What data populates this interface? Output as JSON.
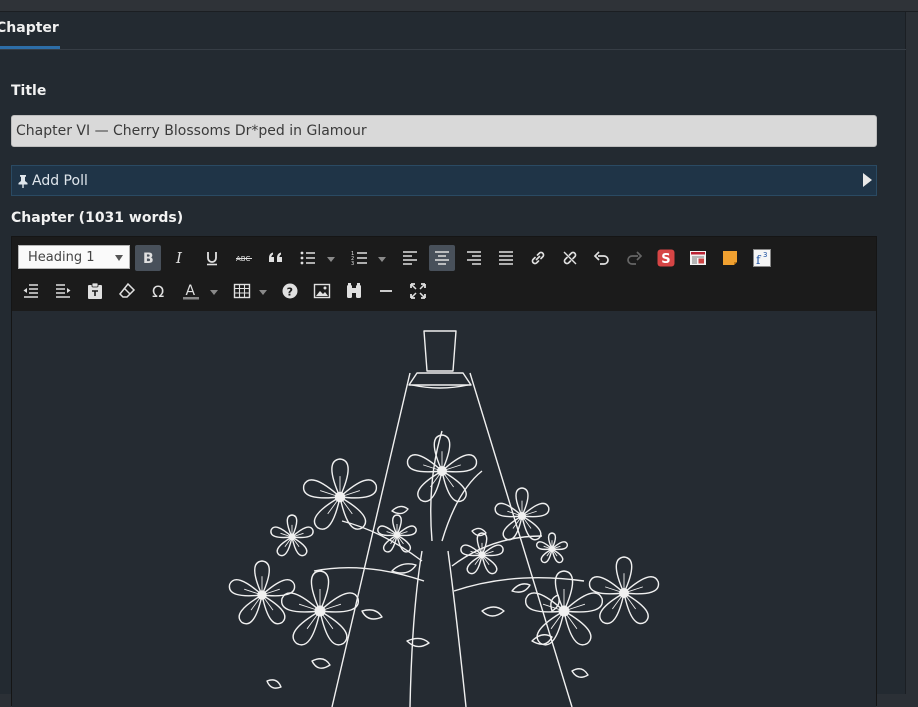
{
  "tabs": {
    "chapter_label": "Chapter"
  },
  "form": {
    "title_label": "Title",
    "title_value": "Chapter VI — Cherry Blossoms Dr*ped in Glamour",
    "add_poll_label": "Add Poll",
    "chapter_label": "Chapter (1031 words)"
  },
  "editor": {
    "format_select": "Heading 1",
    "omega_glyph": "Ω",
    "text_color_glyph": "A",
    "fontsize_glyph": "f",
    "fontsize_sup": "3",
    "spell_glyph": "S"
  },
  "colors": {
    "panel_bg": "#232a31",
    "tab_accent": "#2d6ea8",
    "poll_bg": "#1f3447",
    "toolbar_bg": "#1b1b1b",
    "spell_red": "#d64545",
    "sticky_orange": "#f0a030"
  }
}
